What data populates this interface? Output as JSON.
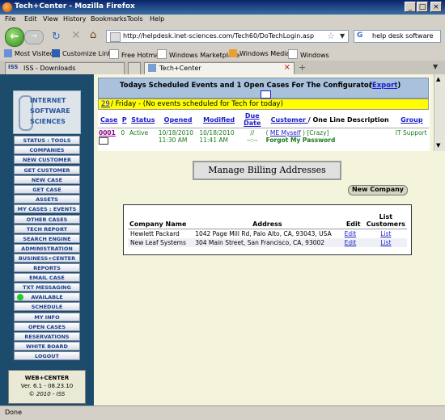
{
  "window": {
    "title": "Tech+Center - Mozilla Firefox"
  },
  "menu": [
    "File",
    "Edit",
    "View",
    "History",
    "Bookmarks",
    "Tools",
    "Help"
  ],
  "nav": {
    "url": "http://helpdesk.inet-sciences.com/Tech60/DoTechLogin.asp",
    "search_value": "help desk software"
  },
  "bookmarks": [
    "Most Visited",
    "Customize Links",
    "Free Hotmail",
    "Windows Marketplace",
    "Windows Media",
    "Windows"
  ],
  "tabs": [
    {
      "label": "ISS - Downloads"
    },
    {
      "label": "Tech+Center"
    }
  ],
  "sidebar": {
    "logo_lines": [
      "INTERNET",
      "SOFTWARE",
      "SCIENCES"
    ],
    "items": [
      "STATUS : TOOLS",
      "COMPANIES",
      "NEW CUSTOMER",
      "GET CUSTOMER",
      "NEW CASE",
      "GET CASE",
      "ASSETS",
      "MY CASES : EVENTS",
      "OTHER CASES",
      "TECH REPORT",
      "SEARCH ENGINE",
      "ADMINISTRATION",
      "BUSINESS+CENTER",
      "REPORTS",
      "EMAIL CASE",
      "TXT MESSAGING",
      "AVAILABLE",
      "SCHEDULE",
      "MY INFO",
      "OPEN CASES",
      "RESERVATIONS",
      "WHITE BOARD",
      "LOGOUT"
    ],
    "footer": {
      "title": "WEB+CENTER",
      "version": "Ver. 6.1 - 08.23.10",
      "copyright": "© 2010 - ISS"
    }
  },
  "events": {
    "header": "Todays Scheduled Events and 1  Open Cases For  The Configurator",
    "export_label": "Export",
    "day_num": "29",
    "day_text": " / Friday - (No events scheduled for Tech for today)",
    "columns": [
      "Case",
      "P",
      "Status",
      "Opened",
      "Modified",
      "Due Date",
      "Customer",
      "/ One Line Description",
      "Group"
    ],
    "row": {
      "case": "0001",
      "p": "0",
      "status": "Active",
      "opened_date": "10/18/2010",
      "opened_time": "11:30 AM",
      "modified_date": "10/18/2010",
      "modified_time": "11:41 AM",
      "due_1": "//",
      "due_2": "--:--",
      "customer": "ME Myself",
      "company": "[Crazy]",
      "description": "Forgot My Password",
      "group": "IT Support"
    }
  },
  "billing": {
    "title": "Manage Billing Addresses",
    "new_company": "New Company",
    "columns": {
      "company": "Company Name",
      "address": "Address",
      "edit": "Edit",
      "list": "List Customers"
    },
    "rows": [
      {
        "company": "Hewlett Packard",
        "address": "1042 Page Mill Rd, Palo Alto, CA, 93043, USA",
        "edit": "Edit",
        "list": "List"
      },
      {
        "company": "New Leaf Systems",
        "address": "304 Main Street, San Francisco, CA, 93002",
        "edit": "Edit",
        "list": "List"
      }
    ]
  },
  "status": {
    "text": "Done"
  }
}
